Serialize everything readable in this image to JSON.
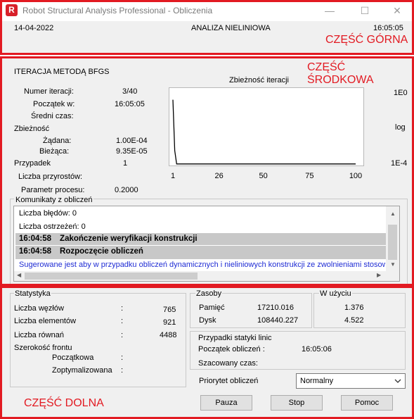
{
  "window": {
    "title": "Robot Structural Analysis Professional - Obliczenia",
    "app_icon_letter": "R",
    "minimize_glyph": "—",
    "maximize_glyph": "☐",
    "close_glyph": "✕"
  },
  "header": {
    "date": "14-04-2022",
    "mode": "ANALIZA NIELINIOWA",
    "time": "16:05:05"
  },
  "sections": {
    "top": "CZĘŚĆ GÓRNA",
    "middle": "CZĘŚĆ ŚRODKOWA",
    "bottom": "CZĘŚĆ DOLNA"
  },
  "iteration": {
    "method_title": "ITERACJA METODĄ BFGS",
    "labels": {
      "iter_count": "Numer iteracji:",
      "start": "Początek w:",
      "avg_time": "Średni czas:",
      "convergence": "Zbieżność",
      "required": "Żądana:",
      "current": "Bieżąca:",
      "case": "Przypadek",
      "increments": "Liczba przyrostów:",
      "process_param": "Parametr procesu:"
    },
    "values": {
      "iter_count": "3/40",
      "start": "16:05:05",
      "avg_time": "",
      "required": "1.00E-04",
      "current": "9.35E-05",
      "case": "1",
      "increments": "",
      "process_param": "0.2000"
    }
  },
  "chart_data": {
    "type": "line",
    "title": "Zbieżność iteracji",
    "xlabel": "",
    "ylabel": "",
    "x_ticks": [
      "1",
      "26",
      "50",
      "75",
      "100"
    ],
    "xlim": [
      1,
      100
    ],
    "y_scale": "log",
    "y_scale_label": "log",
    "y_top_label": "1E0",
    "y_bottom_label": "1E-4",
    "ylim": [
      0.0001,
      1
    ],
    "grid": false,
    "series": [
      {
        "x": [
          1,
          2,
          3,
          100
        ],
        "y": [
          0.3,
          0.0005,
          9.35e-05,
          9.35e-05
        ]
      }
    ]
  },
  "messages": {
    "group_label": "Komunikaty z obliczeń",
    "rows": [
      {
        "text": "Liczba błędów: 0"
      },
      {
        "text": "Liczba ostrzeżeń: 0"
      },
      {
        "time": "16:04:58",
        "text": "Zakończenie weryfikacji konstrukcji"
      },
      {
        "time": "16:04:58",
        "text": "Rozpoczęcie obliczeń"
      },
      {
        "text": "Sugerowane jest aby w przypadku obliczeń dynamicznych i nieliniowych konstrukcji ze zwolnieniami stosować"
      }
    ],
    "info_color": "#1f2cd4"
  },
  "stats": {
    "title": "Statystyka",
    "rows": [
      {
        "label": "Liczba węzłów",
        "value": "765"
      },
      {
        "label": "Liczba elementów",
        "value": "921"
      },
      {
        "label": "Liczba równań",
        "value": "4488"
      }
    ],
    "front_width": "Szerokość frontu",
    "initial": "Początkowa",
    "optimized": "Zoptymalizowana",
    "colon": ":"
  },
  "resources": {
    "title": "Zasoby",
    "in_use_title": "W użyciu",
    "memory_label": "Pamięć",
    "memory_value": "17210.016",
    "memory_used": "1.376",
    "disk_label": "Dysk",
    "disk_value": "108440.227",
    "disk_used": "4.522"
  },
  "linear_cases": {
    "title": "Przypadki statyki linic",
    "start_label": "Początek obliczeń :",
    "start_value": "16:05:06",
    "estimated_label": "Szacowany czas:"
  },
  "priority": {
    "label": "Priorytet obliczeń",
    "selected": "Normalny"
  },
  "buttons": {
    "pause": "Pauza",
    "stop": "Stop",
    "help": "Pomoc"
  },
  "colors": {
    "frame": "#e21a22",
    "panel": "#f0f0f0",
    "highlight": "#c8c8c8"
  }
}
